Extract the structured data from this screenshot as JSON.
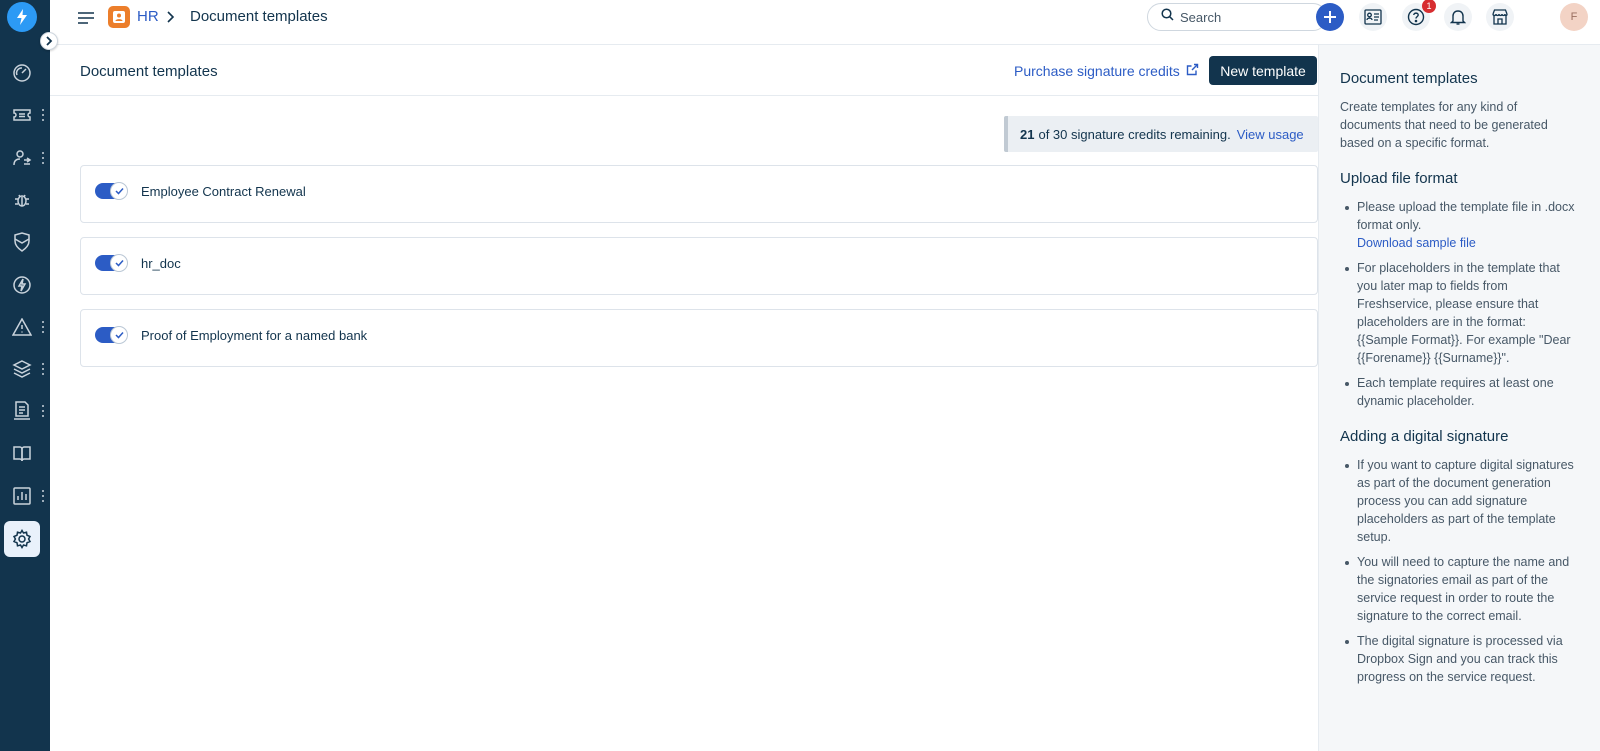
{
  "header": {
    "module": "HR",
    "current": "Document templates",
    "search_placeholder": "Search",
    "help_badge": "1",
    "avatar_initial": "F"
  },
  "main": {
    "title": "Document templates",
    "purchase_link": "Purchase signature credits",
    "new_template_button": "New template",
    "credits": {
      "count": "21",
      "text": "of 30 signature credits remaining.",
      "link": "View usage"
    },
    "templates": [
      {
        "name": "Employee Contract Renewal",
        "enabled": true
      },
      {
        "name": "hr_doc",
        "enabled": true
      },
      {
        "name": "Proof of Employment for a named bank",
        "enabled": true
      }
    ]
  },
  "side_panel": {
    "title": "Document templates",
    "intro": "Create templates for any kind of documents that need to be generated based on a specific format.",
    "upload_title": "Upload file format",
    "upload_items": [
      "Please upload the template file in .docx format only.",
      "For placeholders in the template that you later map to fields from Freshservice, please ensure that placeholders are in the format: {{Sample Format}}. For example \"Dear {{Forename}} {{Surname}}\".",
      "Each template requires at least one dynamic placeholder."
    ],
    "download_link": "Download sample file",
    "signature_title": "Adding a digital signature",
    "signature_items": [
      "If you want to capture digital signatures as part of the document generation process you can add signature placeholders as part of the template setup.",
      "You will need to capture the name and the signatories email as part of the service request in order to route the signature to the correct email.",
      "The digital signature is processed via Dropbox Sign and you can track this progress on the service request."
    ]
  },
  "colors": {
    "nav_bg": "#12344d",
    "accent": "#2c5cc5",
    "module_badge": "#ec7e2b",
    "logo": "#2c9af5",
    "alert": "#d72d30"
  },
  "icons": {
    "nav": [
      "dashboard-icon",
      "tickets-icon",
      "user-swap-icon",
      "bug-icon",
      "shield-icon",
      "lightning-icon",
      "alert-icon",
      "layers-icon",
      "document-icon",
      "book-icon",
      "reports-icon",
      "settings-icon"
    ],
    "header": [
      "menu-icon",
      "hr-badge-icon",
      "chevron-right-icon",
      "search-icon",
      "plus-icon",
      "contacts-icon",
      "help-icon",
      "bell-icon",
      "store-icon"
    ]
  }
}
